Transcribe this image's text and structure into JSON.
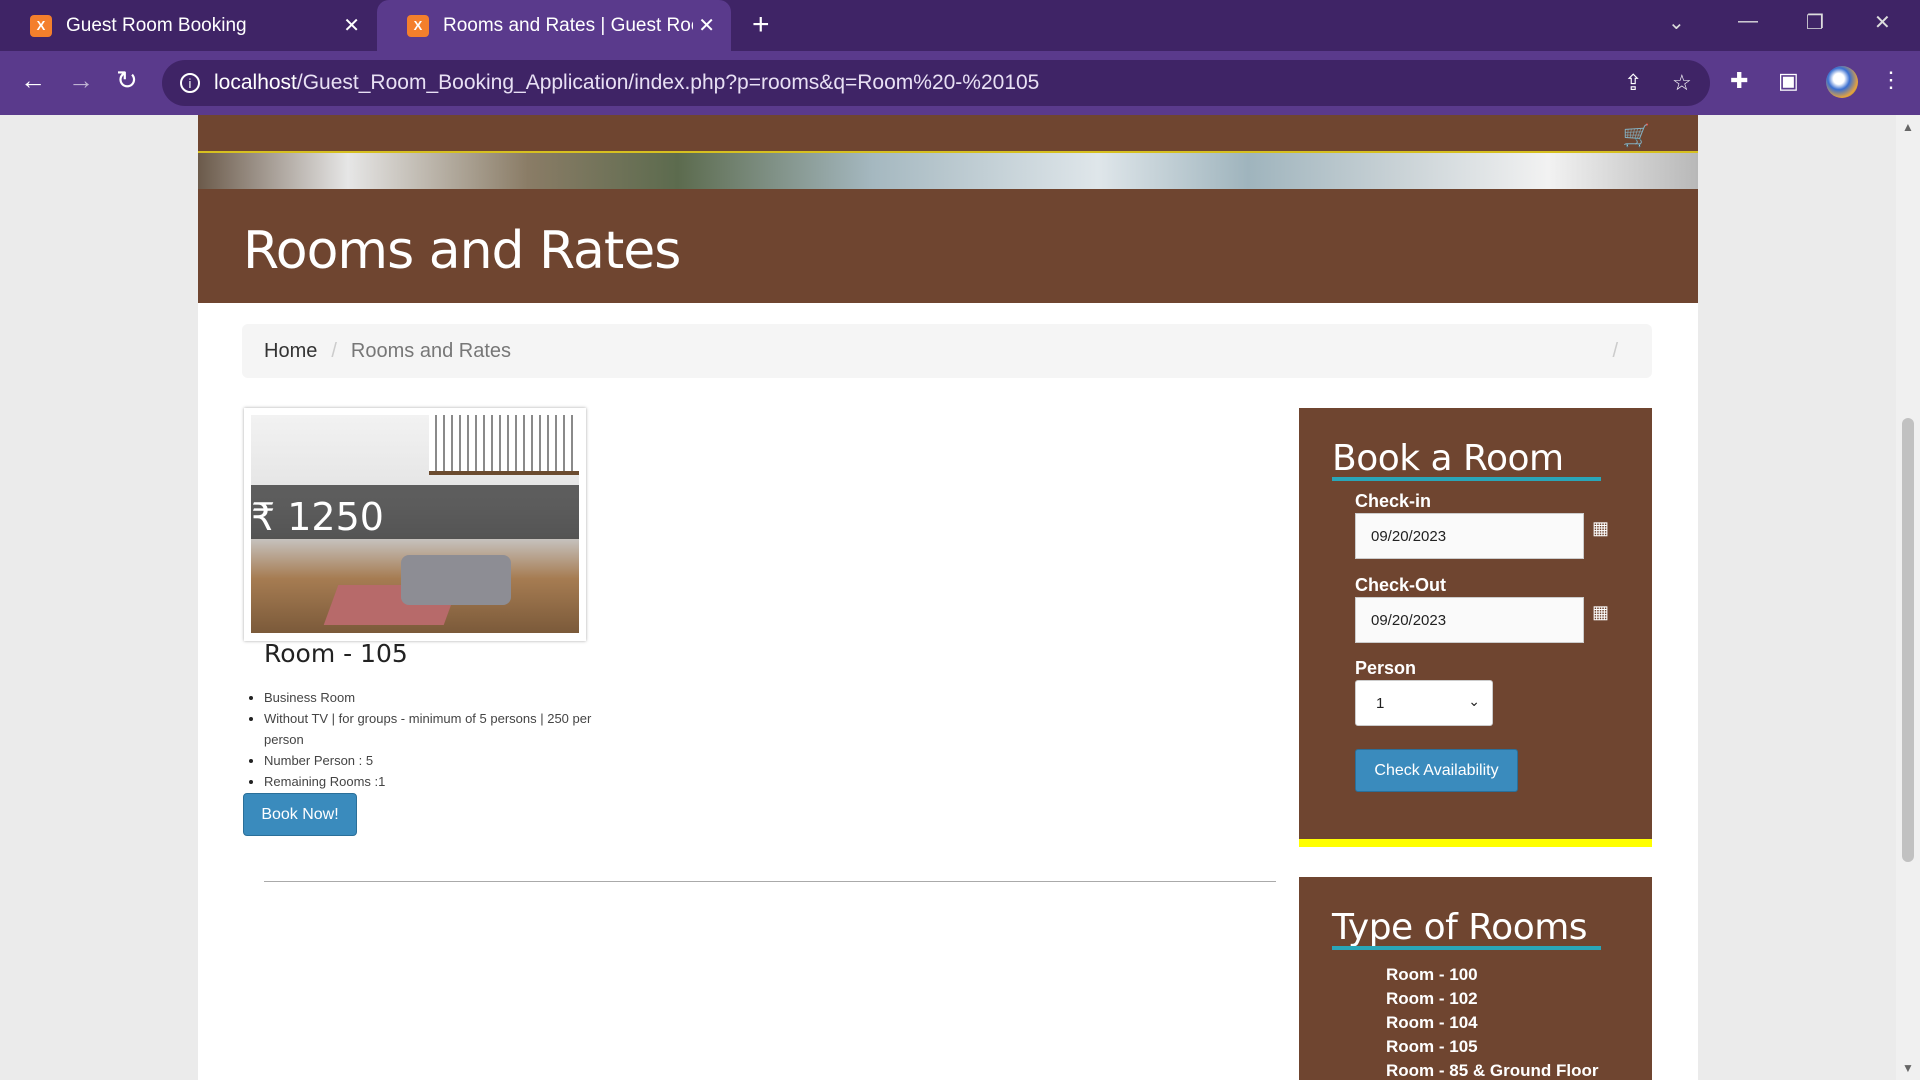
{
  "browser": {
    "tabs": [
      {
        "title": "Guest Room Booking",
        "active": false
      },
      {
        "title": "Rooms and Rates | Guest Room Booking",
        "active": true
      }
    ],
    "url_host": "localhost",
    "url_path": "/Guest_Room_Booking_Application/index.php?p=rooms&q=Room%20-%20105",
    "icons": [
      "back-icon",
      "forward-icon",
      "reload-icon",
      "info-icon",
      "share-icon",
      "star-icon",
      "extensions-icon",
      "sidepanel-icon",
      "menu-icon"
    ]
  },
  "page": {
    "heading": "Rooms and Rates",
    "breadcrumb": {
      "home": "Home",
      "current": "Rooms and Rates",
      "trail": "/"
    },
    "room": {
      "price": "₹ 1250",
      "name": "Room - 105",
      "features": [
        "Business Room",
        "Without TV | for groups - minimum of 5 persons | 250 per person",
        "Number Person : 5",
        "Remaining Rooms :1"
      ],
      "book_label": "Book Now!"
    },
    "booking": {
      "title": "Book a Room",
      "checkin_label": "Check-in",
      "checkin_value": "09/20/2023",
      "checkout_label": "Check-Out",
      "checkout_value": "09/20/2023",
      "person_label": "Person",
      "person_value": "1",
      "button_label": "Check Availability"
    },
    "types": {
      "title": "Type of Rooms",
      "items": [
        "Room - 100",
        "Room - 102",
        "Room - 104",
        "Room - 105",
        "Room - 85 & Ground Floor"
      ]
    }
  },
  "colors": {
    "brand_brown": "#6f4530",
    "button_blue": "#3a8bbd",
    "accent_teal": "#2aa6b8",
    "accent_yellow": "#ffff00",
    "chrome_purple": "#5a3a8c"
  }
}
